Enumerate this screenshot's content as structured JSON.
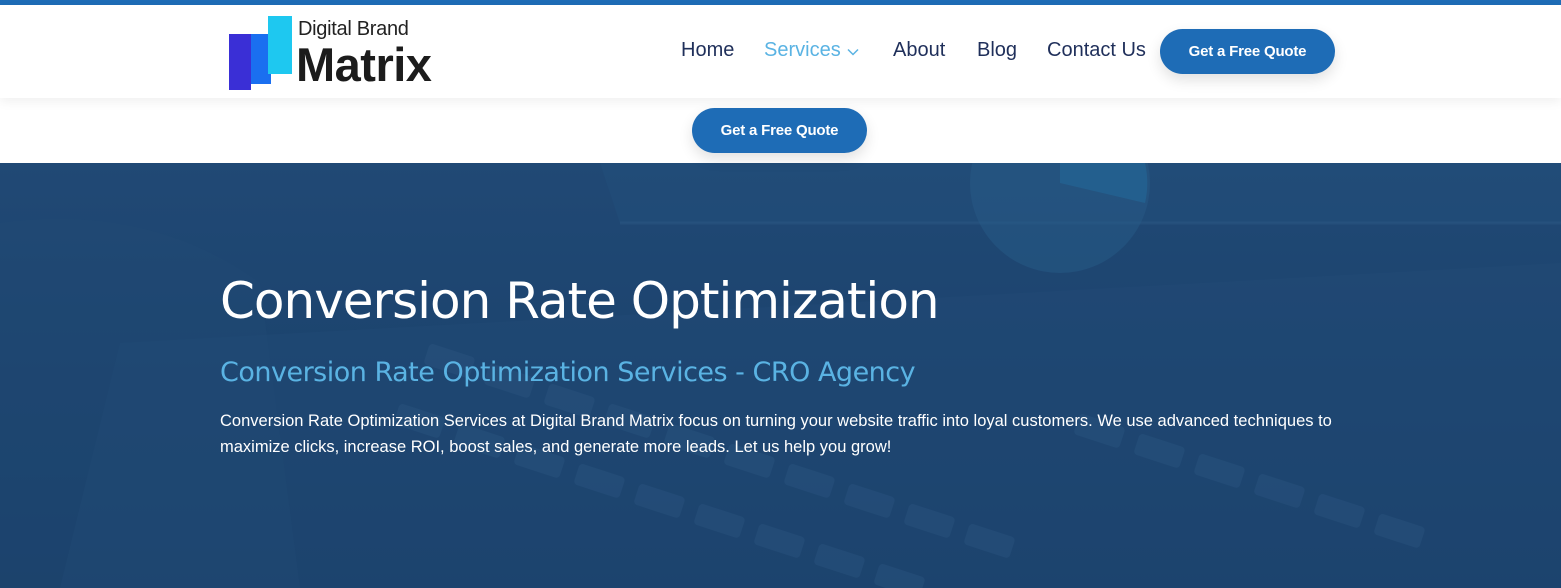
{
  "brand": {
    "logo_top": "Digital Brand",
    "logo_main": "Matrix",
    "colors": {
      "bar_dark": "#3a2fd6",
      "bar_mid": "#1a6ff0",
      "bar_light": "#1ec8f0"
    }
  },
  "nav": {
    "items": [
      {
        "label": "Home"
      },
      {
        "label": "Services"
      },
      {
        "label": "About"
      },
      {
        "label": "Blog"
      },
      {
        "label": "Contact Us"
      }
    ],
    "cta_label": "Get a Free Quote"
  },
  "floating_cta": {
    "label": "Get a Free Quote"
  },
  "hero": {
    "title": "Conversion Rate Optimization",
    "subtitle": "Conversion Rate Optimization Services - CRO Agency",
    "description": "Conversion Rate Optimization Services at Digital Brand Matrix focus on turning your website traffic into loyal customers. We use advanced techniques to maximize clicks, increase ROI, boost sales, and generate more leads. Let us help you grow!"
  },
  "theme": {
    "accent": "#1e6cb6",
    "nav_text": "#1f2f5a",
    "nav_active": "#5ab3e3",
    "hero_bg": "#1f4874"
  },
  "icons": {
    "dropdown": "chevron-down-icon"
  }
}
